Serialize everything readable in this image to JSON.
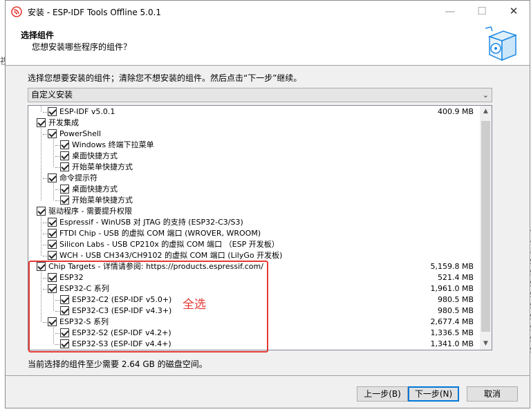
{
  "window": {
    "title": "安装 - ESP-IDF Tools Offline 5.0.1",
    "controls": [
      "—",
      "☐",
      "✕"
    ]
  },
  "header": {
    "title": "选择组件",
    "subtitle": "您想安装哪些程序的组件？"
  },
  "instruction": "选择您想要安装的组件；清除您不想安装的组件。然后点击“下一步”继续。",
  "install_type": {
    "selected": "自定义安装"
  },
  "components": [
    {
      "label": "ESP-IDF v5.0.1",
      "size": "400.9 MB",
      "level": 1,
      "checked": true
    },
    {
      "label": "开发集成",
      "size": "",
      "level": 0,
      "checked": true
    },
    {
      "label": "PowerShell",
      "size": "",
      "level": 1,
      "checked": true
    },
    {
      "label": "Windows 终端下拉菜单",
      "size": "",
      "level": 2,
      "checked": true
    },
    {
      "label": "桌面快捷方式",
      "size": "",
      "level": 2,
      "checked": true
    },
    {
      "label": "开始菜单快捷方式",
      "size": "",
      "level": 2,
      "checked": true
    },
    {
      "label": "命令提示符",
      "size": "",
      "level": 1,
      "checked": true
    },
    {
      "label": "桌面快捷方式",
      "size": "",
      "level": 2,
      "checked": true
    },
    {
      "label": "开始菜单快捷方式",
      "size": "",
      "level": 2,
      "checked": true
    },
    {
      "label": "驱动程序 - 需要提升权限",
      "size": "",
      "level": 0,
      "checked": true
    },
    {
      "label": "Espressif - WinUSB 对 JTAG 的支持 (ESP32-C3/S3)",
      "size": "",
      "level": 1,
      "checked": true
    },
    {
      "label": "FTDI Chip - USB 的虚拟 COM 端口 (WROVER, WROOM)",
      "size": "",
      "level": 1,
      "checked": true
    },
    {
      "label": "Silicon Labs - USB CP210x 的虚拟 COM 端口 （ESP 开发板）",
      "size": "",
      "level": 1,
      "checked": true
    },
    {
      "label": "WCH - USB CH343/CH9102 的虚拟 COM 端口 (LilyGo  开发板)",
      "size": "",
      "level": 1,
      "checked": true
    },
    {
      "label": "Chip Targets - 详情请参阅: https://products.espressif.com/",
      "size": "5,159.8 MB",
      "level": 0,
      "checked": true
    },
    {
      "label": "ESP32",
      "size": "521.4 MB",
      "level": 1,
      "checked": true
    },
    {
      "label": "ESP32-C 系列",
      "size": "1,961.0 MB",
      "level": 1,
      "checked": true
    },
    {
      "label": "ESP32-C2 (ESP-IDF v5.0+)",
      "size": "980.5 MB",
      "level": 2,
      "checked": true
    },
    {
      "label": "ESP32-C3 (ESP-IDF v4.3+)",
      "size": "980.5 MB",
      "level": 2,
      "checked": true
    },
    {
      "label": "ESP32-S 系列",
      "size": "2,677.4 MB",
      "level": 1,
      "checked": true
    },
    {
      "label": "ESP32-S2 (ESP-IDF v4.2+)",
      "size": "1,336.5 MB",
      "level": 2,
      "checked": true
    },
    {
      "label": "ESP32-S3 (ESP-IDF v4.4+)",
      "size": "1,341.0 MB",
      "level": 2,
      "checked": true
    }
  ],
  "annotation": {
    "note": "全选",
    "color": "#e53935"
  },
  "disk_requirement": "当前选择的组件至少需要 2.64 GB 的磁盘空间。",
  "buttons": {
    "back": "上一步(B)",
    "next": "下一步(N)",
    "cancel": "取消"
  },
  "background_window": {
    "left_char": "视",
    "right_chars": [
      "1",
      "1",
      "1",
      "2",
      "2",
      "2",
      "2",
      "2",
      "2",
      "2",
      "2",
      "2"
    ]
  }
}
